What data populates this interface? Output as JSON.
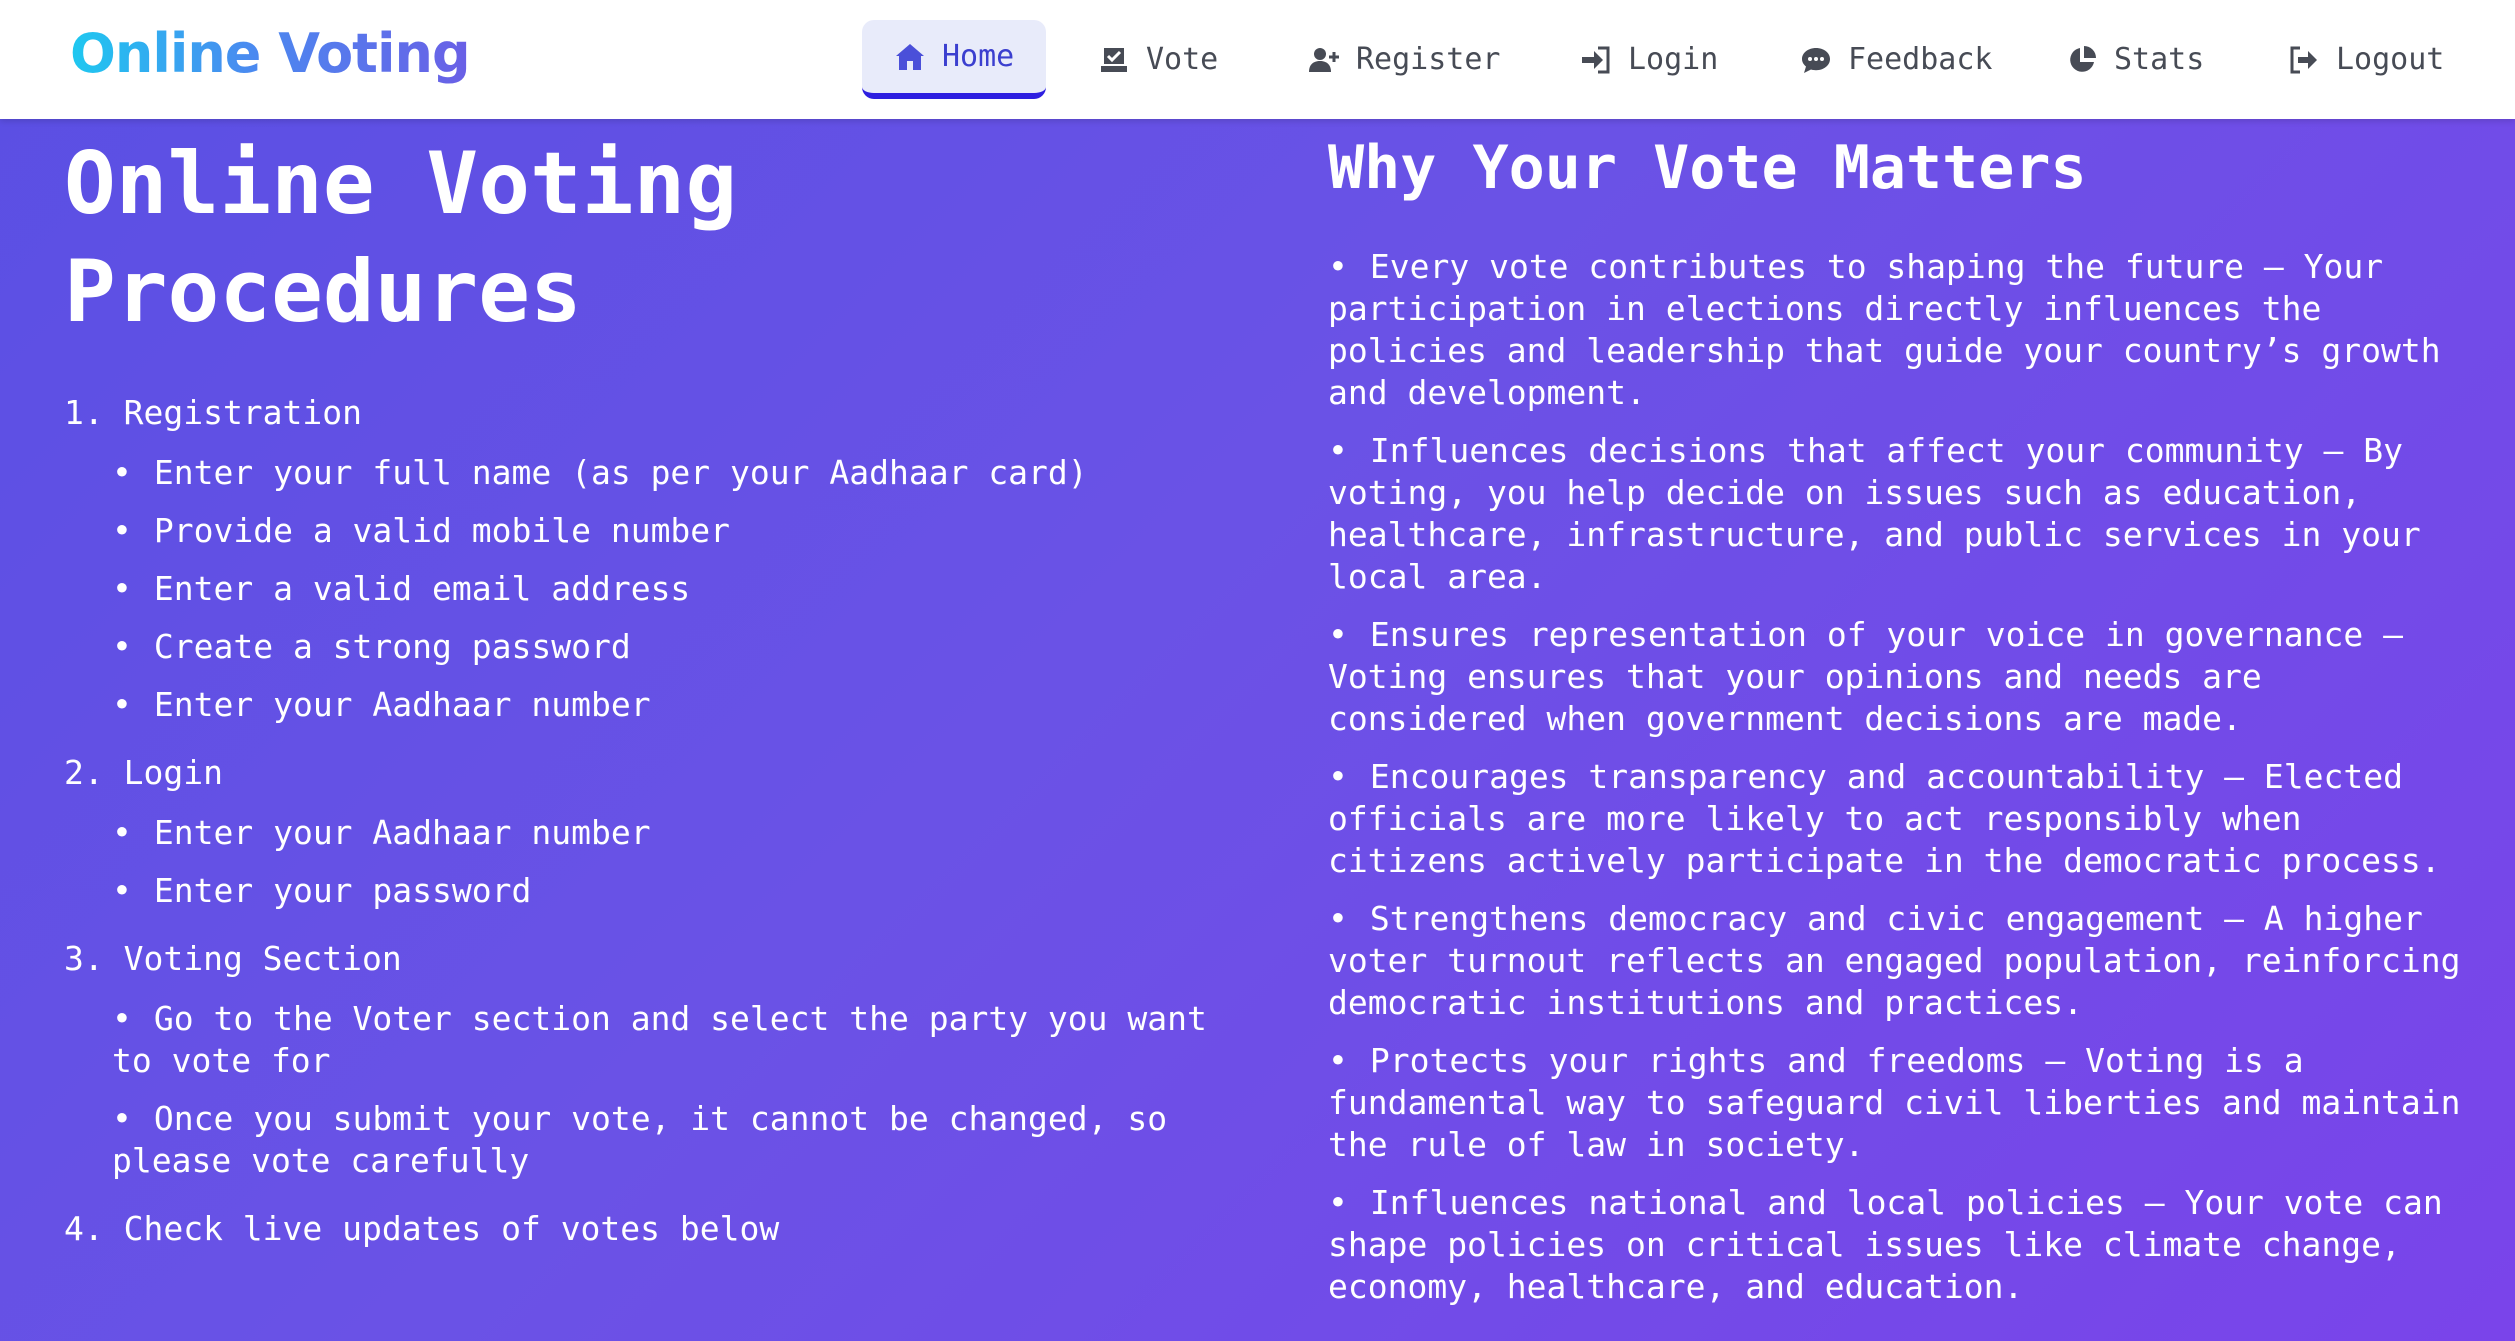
{
  "brand": "Online Voting",
  "nav": {
    "home": "Home",
    "vote": "Vote",
    "register": "Register",
    "login": "Login",
    "feedback": "Feedback",
    "stats": "Stats",
    "logout": "Logout"
  },
  "procedures": {
    "title_line1": "Online Voting",
    "title_line2": "Procedures",
    "steps": [
      {
        "title": "1. Registration",
        "items": [
          "Enter your full name (as per your Aadhaar card)",
          "Provide a valid mobile number",
          "Enter a valid email address",
          "Create a strong password",
          "Enter your Aadhaar number"
        ]
      },
      {
        "title": "2. Login",
        "items": [
          "Enter your Aadhaar number",
          "Enter your password"
        ]
      },
      {
        "title": "3. Voting Section",
        "items": [
          "Go to the Voter section and select the party you want to vote for",
          "Once you submit your vote, it cannot be changed, so please vote carefully"
        ]
      },
      {
        "title": "4. Check live updates of votes below"
      }
    ]
  },
  "why": {
    "title": "Why Your Vote Matters",
    "items": [
      "Every vote contributes to shaping the future – Your participation in elections directly influences the policies and leadership that guide your country’s growth and development.",
      "Influences decisions that affect your community – By voting, you help decide on issues such as education, healthcare, infrastructure, and public services in your local area.",
      "Ensures representation of your voice in governance – Voting ensures that your opinions and needs are considered when government decisions are made.",
      "Encourages transparency and accountability – Elected officials are more likely to act responsibly when citizens actively participate in the democratic process.",
      "Strengthens democracy and civic engagement – A higher voter turnout reflects an engaged population, reinforcing democratic institutions and practices.",
      "Protects your rights and freedoms – Voting is a fundamental way to safeguard civil liberties and maintain the rule of law in society.",
      "Influences national and local policies – Your vote can shape policies on critical issues like climate change, economy, healthcare, and education."
    ]
  },
  "colors": {
    "background_start": "#5a4fe3",
    "background_end": "#7a44ea",
    "nav_active_bg": "#e8ebfa",
    "nav_active_border": "#2e1fe0"
  },
  "icons": {
    "home": "house-icon",
    "vote": "ballot-box-icon",
    "register": "user-plus-icon",
    "login": "sign-in-icon",
    "feedback": "chat-bubble-icon",
    "stats": "pie-chart-icon",
    "logout": "sign-out-icon"
  }
}
